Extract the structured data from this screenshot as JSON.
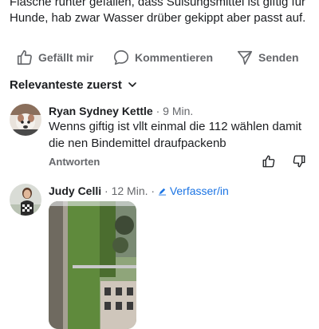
{
  "post": {
    "text": "Flasche runter gefallen, dass Sulsungsmittel ist giftig für Hunde, hab zwar Wasser drüber gekippt aber passt auf."
  },
  "actions": {
    "like": "Gefällt mir",
    "comment": "Kommentieren",
    "send": "Senden"
  },
  "sort": {
    "label": "Relevanteste zuerst"
  },
  "comments": [
    {
      "name": "Ryan Sydney Kettle",
      "time": "· 9 Min.",
      "text": "Wenns giftig ist vllt einmal die 112 wählen damit die nen Bindemittel draufpackenb",
      "reply": "Antworten"
    },
    {
      "name": "Judy Celli",
      "time": "· 12 Min. ·",
      "badge": "Verfasser/in"
    }
  ],
  "colors": {
    "meta": "#65676b",
    "accent": "#1b74e4",
    "text": "#1c1e21"
  },
  "icons": [
    "like-icon",
    "comment-icon",
    "send-icon",
    "chevron-down-icon",
    "thumbs-up-icon",
    "thumbs-down-icon",
    "pencil-icon"
  ]
}
